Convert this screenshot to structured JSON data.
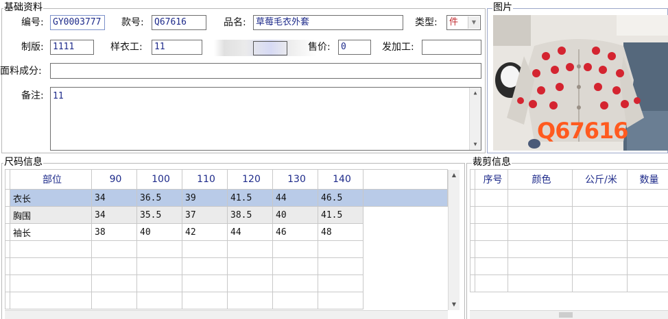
{
  "basic": {
    "legend": "基础资料",
    "code_label": "编号:",
    "code_value": "GY0003777",
    "style_label": "款号:",
    "style_value": "Q67616",
    "product_label": "品名:",
    "product_value": "草莓毛衣外套",
    "type_label": "类型:",
    "type_value": "件",
    "plate_label": "制版:",
    "plate_value": "1111",
    "sample_label": "样衣工:",
    "sample_value": "11",
    "price_label": "售价:",
    "price_value": "0",
    "process_label": "发加工:",
    "process_value": "",
    "fabric_label": "面料成分:",
    "fabric_value": "",
    "note_label": "备注:",
    "note_value": "11"
  },
  "picture": {
    "legend": "图片",
    "overlay_text": "Q67616"
  },
  "size_info": {
    "legend": "尺码信息",
    "columns": [
      "部位",
      "90",
      "100",
      "110",
      "120",
      "130",
      "140"
    ],
    "rows": [
      {
        "name": "衣长",
        "values": [
          "34",
          "36.5",
          "39",
          "41.5",
          "44",
          "46.5"
        ]
      },
      {
        "name": "胸围",
        "values": [
          "34",
          "35.5",
          "37",
          "38.5",
          "40",
          "41.5"
        ]
      },
      {
        "name": "袖长",
        "values": [
          "38",
          "40",
          "42",
          "44",
          "46",
          "48"
        ]
      }
    ]
  },
  "cut_info": {
    "legend": "裁剪信息",
    "columns": [
      "序号",
      "颜色",
      "公斤/米",
      "数量"
    ]
  },
  "colors": {
    "field_text": "#1d2a8a",
    "selected_row": "#b9cbe8",
    "type_value": "#c0282d"
  }
}
